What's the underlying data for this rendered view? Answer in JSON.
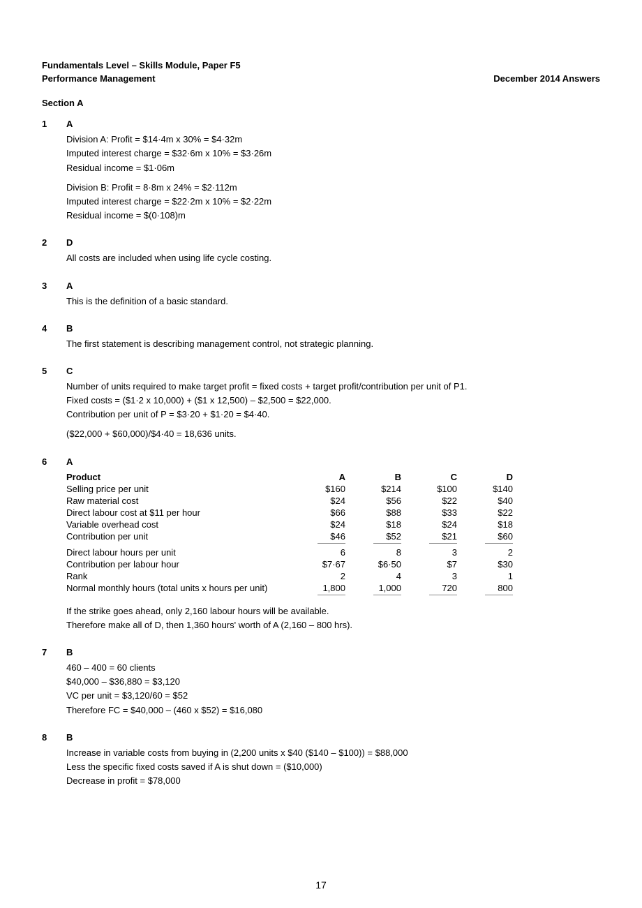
{
  "header": {
    "line1": "Fundamentals Level – Skills Module, Paper F5",
    "line2_left": "Performance Management",
    "line2_right": "December 2014 Answers"
  },
  "section_a": "Section A",
  "questions": [
    {
      "num": "1",
      "ans": "A",
      "paras": [
        "Division A: Profit = $14·4m x 30%  = $4·32m",
        "Imputed interest charge = $32·6m x 10%  = $3·26m",
        "Residual income = $1·06m"
      ],
      "paras2": [
        "Division B: Profit = 8·8m x 24%  = $2·112m",
        "Imputed interest charge = $22·2m x 10%  = $2·22m",
        "Residual income = $(0·108)m"
      ]
    },
    {
      "num": "2",
      "ans": "D",
      "paras": [
        "All costs are included when using life  cycle costing."
      ]
    },
    {
      "num": "3",
      "ans": "A",
      "paras": [
        "This is the definition of a basic  standard."
      ]
    },
    {
      "num": "4",
      "ans": "B",
      "paras": [
        "The first statement is describing management control,  not strategic planning."
      ]
    },
    {
      "num": "5",
      "ans": "C",
      "paras": [
        "Number of units required to make target  profit = fixed costs + target profit/contribution per unit of  P1.",
        "Fixed costs = ($1·2 x 10,000) +  ($1 x 12,500) – $2,500 = $22,000.",
        "Contribution per unit of P = $3·20  + $1·20 = $4·40."
      ],
      "paras2": [
        "($22,000 + $60,000)/$4·40 = 18,636 units."
      ]
    },
    {
      "num": "6",
      "ans": "A",
      "table": {
        "head": [
          "Product",
          "A",
          "B",
          "C",
          "D"
        ],
        "rows": [
          [
            "Selling price per unit",
            "$160",
            "$214",
            "$100",
            "$140"
          ],
          [
            "Raw material cost",
            "$24",
            "$56",
            "$22",
            "$40"
          ],
          [
            "Direct labour cost at $11 per hour",
            "$66",
            "$88",
            "$33",
            "$22"
          ],
          [
            "Variable overhead cost",
            "$24",
            "$18",
            "$24",
            "$18"
          ],
          [
            "Contribution per unit",
            "$46",
            "$52",
            "$21",
            "$60"
          ]
        ],
        "rows2": [
          [
            "Direct labour hours per unit",
            "6",
            "8",
            "3",
            "2"
          ],
          [
            "Contribution per labour hour",
            "$7·67",
            "$6·50",
            "$7",
            "$30"
          ],
          [
            "Rank",
            "2",
            "4",
            "3",
            "1"
          ],
          [
            "Normal monthly hours (total units x hours  per unit)",
            "1,800",
            "1,000",
            "720",
            "800"
          ]
        ]
      },
      "paras": [
        "If the strike goes ahead, only 2,160  labour hours will be available.",
        "Therefore make all of D, then 1,360  hours' worth of A (2,160 – 800 hrs)."
      ]
    },
    {
      "num": "7",
      "ans": "B",
      "paras": [
        "460 – 400 = 60 clients",
        "$40,000 – $36,880 = $3,120",
        "VC per unit = $3,120/60 = $52",
        "Therefore FC = $40,000 – (460 x  $52) = $16,080"
      ]
    },
    {
      "num": "8",
      "ans": "B",
      "paras": [
        "Increase in variable costs from buying in  (2,200 units x $40 ($140 – $100)) = $88,000",
        "Less the specific fixed costs saved if  A is shut down = ($10,000)",
        "Decrease in profit = $78,000"
      ]
    }
  ],
  "pagenum": "17"
}
